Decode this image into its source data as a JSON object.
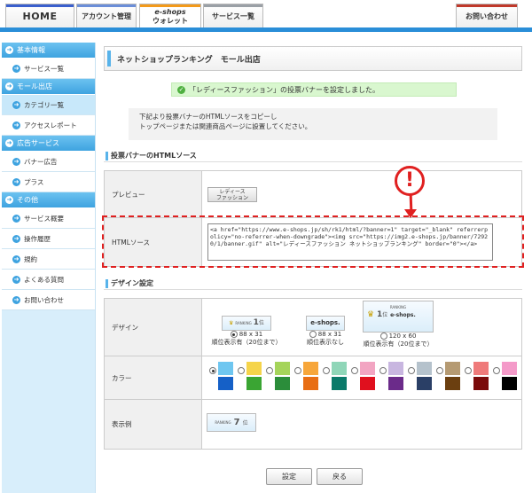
{
  "header": {
    "tabs": [
      {
        "label": "HOME"
      },
      {
        "label": "アカウント管理"
      },
      {
        "label_top": "e-shops",
        "label_bottom": "ウォレット"
      },
      {
        "label": "サービス一覧"
      },
      {
        "label": "お問い合わせ"
      }
    ],
    "stripe_colors": [
      "#3a5fcd",
      "#6b8ed8",
      "#f39a1b",
      "#9aa0a6",
      "#c0392b"
    ]
  },
  "sidebar": {
    "sections": [
      {
        "title": "基本情報",
        "items": [
          "サービス一覧"
        ]
      },
      {
        "title": "モール出店",
        "items": [
          "カテゴリ一覧",
          "アクセスレポート"
        ]
      },
      {
        "title": "広告サービス",
        "items": [
          "バナー広告",
          "プラス"
        ]
      },
      {
        "title": "その他",
        "items": [
          "サービス概要",
          "操作履歴",
          "規約",
          "よくある質問",
          "お問い合わせ"
        ]
      }
    ]
  },
  "main": {
    "page_title": "ネットショップランキング　モール出店",
    "notice": "「レディースファッション」の投票バナーを設定しました。",
    "info_line1": "下記より投票バナーのHTMLソースをコピーし",
    "info_line2": "トップページまたは関連商品ページに設置してください。",
    "source_section": "投票バナーのHTMLソース",
    "preview_label": "プレビュー",
    "preview_banner_line1": "レディース",
    "preview_banner_line2": "ファッション",
    "html_label": "HTMLソース",
    "html_code": "<a href=\"https://www.e-shops.jp/sh/rk1/html/?banner=1\" target=\"_blank\" referrerpolicy=\"no-referrer-when-downgrade\"><img src=\"https://img2.e-shops.jp/banner/72920/1/banner.gif\" alt=\"レディースファッション ネットショップランキング\" border=\"0\"></a>",
    "alert_symbol": "!",
    "design_section": "デザイン設定",
    "design_label": "デザイン",
    "design_options": [
      {
        "size": "88 x 31",
        "desc": "順位表示有（20位まで）",
        "banner_rank_text": "RANKING",
        "banner_rank": "1",
        "banner_unit": "位"
      },
      {
        "size": "88 x 31",
        "desc": "順位表示なし",
        "banner_logo": "e-shops."
      },
      {
        "size": "120 x 60",
        "desc": "順位表示有（20位まで）",
        "banner_rank_text": "RANKING",
        "banner_rank": "1",
        "banner_unit": "位",
        "banner_logo": "e-shops."
      }
    ],
    "color_label": "カラー",
    "colors_top": [
      "#6ec6f0",
      "#f5d44a",
      "#a5d45a",
      "#f7a63a",
      "#8fd6b8",
      "#f2a5c2",
      "#c8b6e0",
      "#b5c2cc",
      "#b59a72",
      "#ef7a7a",
      "#f49ac9"
    ],
    "colors_bottom": [
      "#1560c7",
      "#3aa533",
      "#2b8d3a",
      "#e86e14",
      "#0a7a6a",
      "#e0101e",
      "#6b2b8a",
      "#2a3f66",
      "#6b3f10",
      "#7a0a0a",
      "#000000"
    ],
    "sample_label": "表示例",
    "sample_rank_text": "RANKING",
    "sample_rank": "7",
    "sample_unit": "位",
    "save_button": "設定",
    "back_button": "戻る"
  }
}
